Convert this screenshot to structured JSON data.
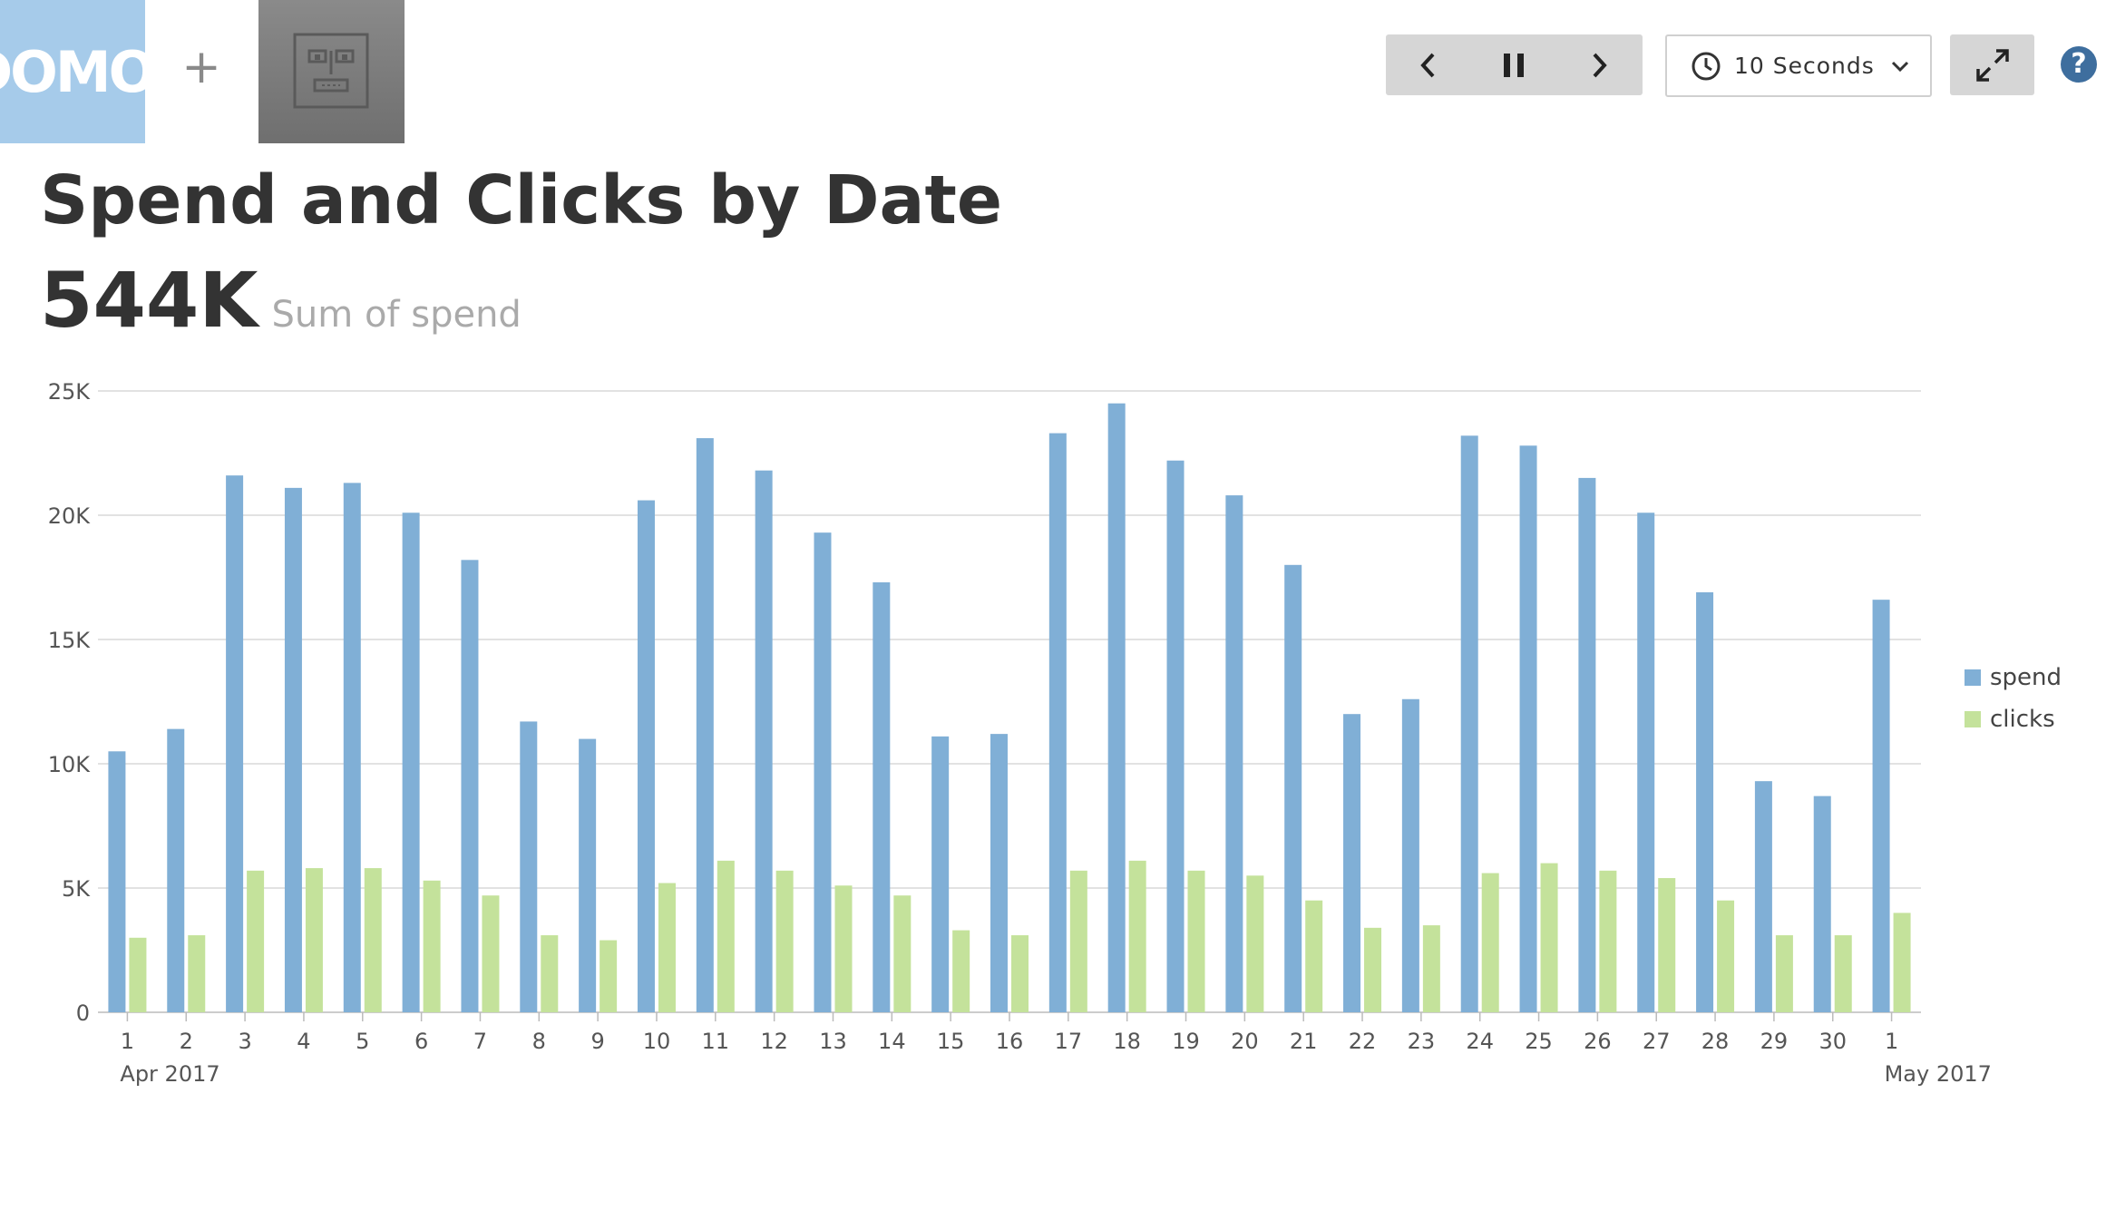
{
  "app": {
    "logo_text": "DOMO",
    "add_label": "+"
  },
  "toolbar": {
    "prev_icon": "chevron-left-icon",
    "pause_icon": "pause-icon",
    "next_icon": "chevron-right-icon",
    "interval_label": "10 Seconds",
    "fullscreen_icon": "expand-icon",
    "help_label": "?"
  },
  "card": {
    "title": "Spend and Clicks by Date",
    "summary_value": "544K",
    "summary_label": "Sum of spend"
  },
  "chart_data": {
    "type": "bar",
    "title": "Spend and Clicks by Date",
    "categories": [
      "1",
      "2",
      "3",
      "4",
      "5",
      "6",
      "7",
      "8",
      "9",
      "10",
      "11",
      "12",
      "13",
      "14",
      "15",
      "16",
      "17",
      "18",
      "19",
      "20",
      "21",
      "22",
      "23",
      "24",
      "25",
      "26",
      "27",
      "28",
      "29",
      "30",
      "1"
    ],
    "x_group_labels": [
      {
        "label": "Apr 2017",
        "at_index": 0
      },
      {
        "label": "May 2017",
        "at_index": 30
      }
    ],
    "series": [
      {
        "name": "spend",
        "color": "#80afd6",
        "values": [
          10500,
          11400,
          21600,
          21100,
          21300,
          20100,
          18200,
          11700,
          11000,
          20600,
          23100,
          21800,
          19300,
          17300,
          11100,
          11200,
          23300,
          24500,
          22200,
          20800,
          18000,
          12000,
          12600,
          23200,
          22800,
          21500,
          20100,
          16900,
          9300,
          8700,
          16600
        ]
      },
      {
        "name": "clicks",
        "color": "#c4e29b",
        "values": [
          3000,
          3100,
          5700,
          5800,
          5800,
          5300,
          4700,
          3100,
          2900,
          5200,
          6100,
          5700,
          5100,
          4700,
          3300,
          3100,
          5700,
          6100,
          5700,
          5500,
          4500,
          3400,
          3500,
          5600,
          6000,
          5700,
          5400,
          4500,
          3100,
          3100,
          4000
        ]
      }
    ],
    "ylim": [
      0,
      25000
    ],
    "yticks": [
      0,
      5000,
      10000,
      15000,
      20000,
      25000
    ],
    "ytick_labels": [
      "0",
      "5K",
      "10K",
      "15K",
      "20K",
      "25K"
    ],
    "grid": true,
    "legend_position": "right"
  }
}
